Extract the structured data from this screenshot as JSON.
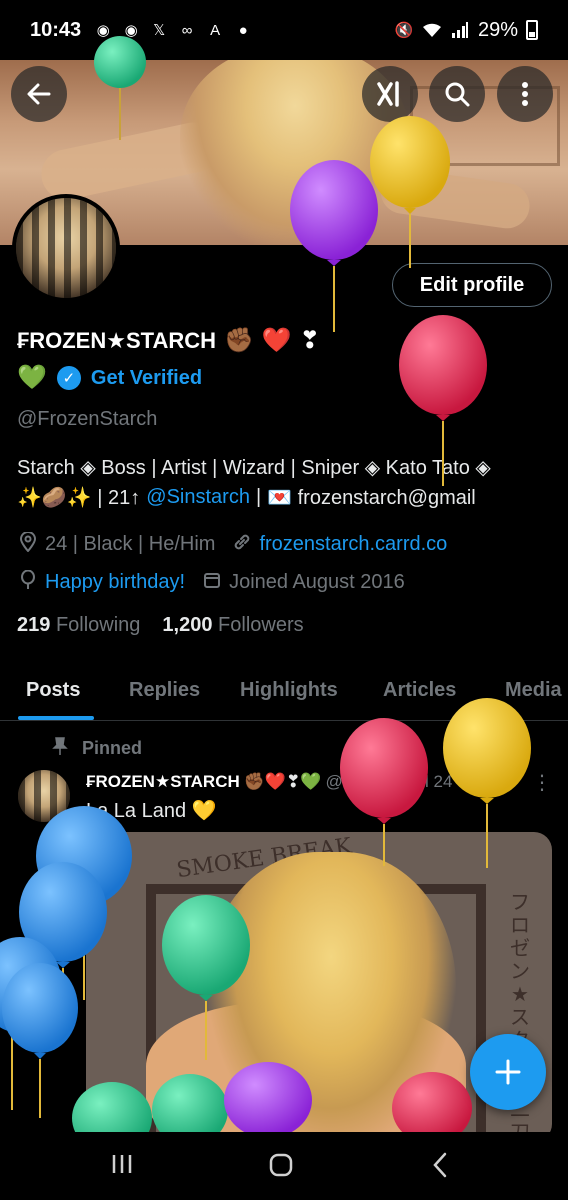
{
  "status": {
    "time": "10:43",
    "battery": "29%",
    "left_icons": [
      "messenger-icon",
      "messenger-icon",
      "x-logo-icon",
      "voicemail-icon",
      "app-icon",
      "alert-icon"
    ],
    "right_icons": [
      "mute-icon",
      "wifi-icon",
      "signal-icon",
      "battery-icon"
    ]
  },
  "header": {
    "back_icon": "arrow-left-icon",
    "grok_icon": "grok-logo-icon",
    "search_icon": "search-icon",
    "more_icon": "more-vertical-icon"
  },
  "profile": {
    "edit_label": "Edit profile",
    "display_name": "₣ROZEN★STARCH",
    "name_emojis": [
      "✊🏾",
      "❤️",
      "❣"
    ],
    "green_heart": "💚",
    "get_verified": "Get Verified",
    "handle": "@FrozenStarch",
    "bio_line1": "Starch ◈ Boss | Artist | Wizard | Sniper ◈ Kato Tato ◈",
    "bio_line2_prefix": "✨🥔✨ | 21↑",
    "bio_mention": "@Sinstarch",
    "bio_line2_sep": "|",
    "bio_email": "💌 frozenstarch@gmail",
    "location": "24 | Black | He/Him",
    "website": "frozenstarch.carrd.co",
    "birthday": "Happy birthday!",
    "joined": "Joined August 2016",
    "following_count": "219",
    "following_label": "Following",
    "followers_count": "1,200",
    "followers_label": "Followers"
  },
  "tabs": [
    {
      "label": "Posts",
      "active": true
    },
    {
      "label": "Replies",
      "active": false
    },
    {
      "label": "Highlights",
      "active": false
    },
    {
      "label": "Articles",
      "active": false
    },
    {
      "label": "Media",
      "active": false
    }
  ],
  "post": {
    "pinned_label": "Pinned",
    "author": "₣ROZEN★STARCH",
    "author_emojis": "✊🏾❤️❣💚",
    "handle": "@F...",
    "date": "30 Jul 24",
    "text": "La La Land 💛",
    "media_title": "SMOKE BREAK",
    "media_jp": "フロゼン★スターチ 二刀"
  },
  "fab_icon": "plus-icon",
  "navbar": {
    "recents_icon": "recents-icon",
    "home_icon": "home-icon",
    "back_icon": "back-icon"
  },
  "colors": {
    "accent": "#1d9bf0",
    "muted": "#71767b",
    "background": "#000000",
    "balloon_green": "#2fd08f",
    "balloon_purple": "#a23cf0",
    "balloon_yellow": "#f3c623",
    "balloon_red": "#e8325a",
    "balloon_blue": "#2d8fe8"
  }
}
